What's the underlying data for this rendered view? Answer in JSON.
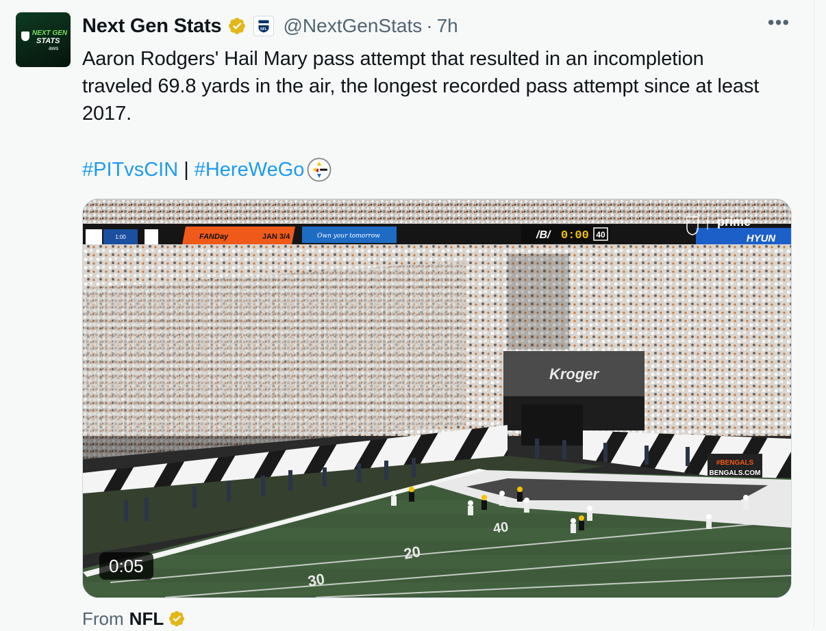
{
  "tweet": {
    "author": {
      "name": "Next Gen Stats",
      "handle": "@NextGenStats",
      "separator": "·",
      "time": "7h",
      "avatar_text_1": "NEXT GEN",
      "avatar_text_2": "STATS",
      "avatar_text_3": "aws"
    },
    "more_label": "•••",
    "text": "Aaron Rodgers' Hail Mary pass attempt that resulted in an incompletion traveled 69.8 yards in the air, the longest recorded pass attempt since at least 2017.",
    "hashtags": [
      "#PITvsCIN",
      "#HereWeGo"
    ],
    "hashtag_separator": "|",
    "media": {
      "duration": "0:05",
      "scorebug": {
        "quarter_clock": "1:00",
        "game_clock": "0:00",
        "play_clock": "40",
        "promo": "JAN 3/4",
        "promo_left": "FANDay",
        "banner": "Own your tomorrow"
      },
      "broadcaster": "prime",
      "sponsor": "HYUN",
      "signage": "Kroger",
      "wall_text_1": "#BENGALS",
      "wall_text_2": "BENGALS.COM",
      "field_numbers": [
        "20",
        "30",
        "40"
      ]
    },
    "source": {
      "label": "From",
      "name": "NFL"
    }
  },
  "colors": {
    "link": "#1d9bf0",
    "verified_gold": "#e2b719",
    "secondary_text": "#536471"
  }
}
